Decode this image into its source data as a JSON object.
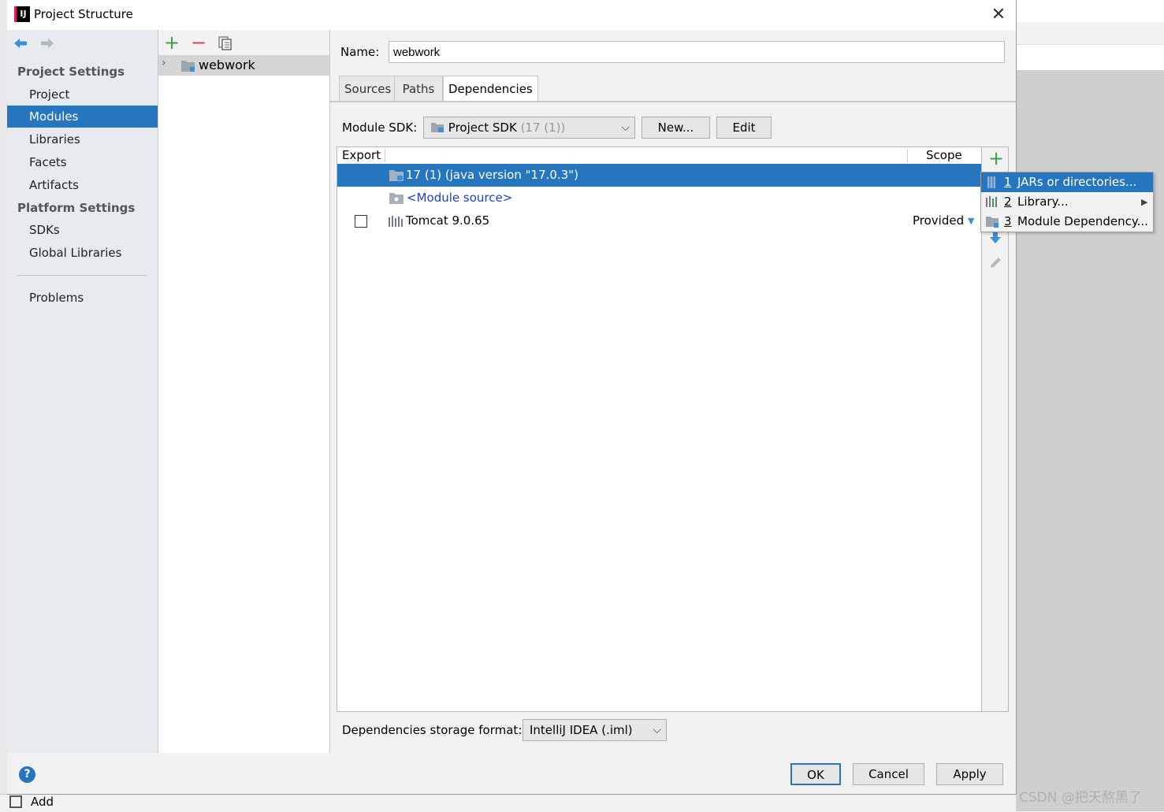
{
  "window": {
    "title": "Project Structure",
    "close_glyph": "✕"
  },
  "nav": {
    "back_icon": "back-arrow-icon",
    "forward_icon": "forward-arrow-icon",
    "project_settings_header": "Project Settings",
    "project_settings_items": [
      "Project",
      "Modules",
      "Libraries",
      "Facets",
      "Artifacts"
    ],
    "selected": "Modules",
    "platform_settings_header": "Platform Settings",
    "platform_settings_items": [
      "SDKs",
      "Global Libraries"
    ],
    "problems": "Problems"
  },
  "tree": {
    "add_glyph": "+",
    "remove_glyph": "−",
    "module_name": "webwork"
  },
  "module": {
    "name_label": "Name:",
    "name_value": "webwork",
    "tabs": [
      "Sources",
      "Paths",
      "Dependencies"
    ],
    "active_tab": "Dependencies",
    "sdk_label": "Module SDK:",
    "sdk_value": "Project SDK",
    "sdk_version": "(17 (1))",
    "new_button": "New...",
    "edit_button": "Edit"
  },
  "deps": {
    "col_export": "Export",
    "col_scope": "Scope",
    "rows": [
      {
        "name": "17 (1) (java version \"17.0.3\")",
        "scope": "",
        "checkbox": false,
        "selected": true
      },
      {
        "name": "<Module source>",
        "scope": "",
        "checkbox": false,
        "selected": false
      },
      {
        "name": "Tomcat 9.0.65",
        "scope": "Provided",
        "checkbox": true,
        "selected": false
      }
    ],
    "storage_label": "Dependencies storage format:",
    "storage_value": "IntelliJ IDEA (.iml)"
  },
  "popup": {
    "items": [
      {
        "num": "1",
        "label": "JARs or directories..."
      },
      {
        "num": "2",
        "label": "Library..."
      },
      {
        "num": "3",
        "label": "Module Dependency..."
      }
    ]
  },
  "footer": {
    "help_glyph": "?",
    "ok": "OK",
    "cancel": "Cancel",
    "apply": "Apply"
  },
  "bottom_bar": {
    "add_label": "Add"
  },
  "watermark": "CSDN @把天熬黑了",
  "colors": {
    "accent": "#2675bf",
    "add_green": "#3aa04a",
    "remove_red": "#d9453d",
    "link_blue": "#1c3fd1"
  }
}
